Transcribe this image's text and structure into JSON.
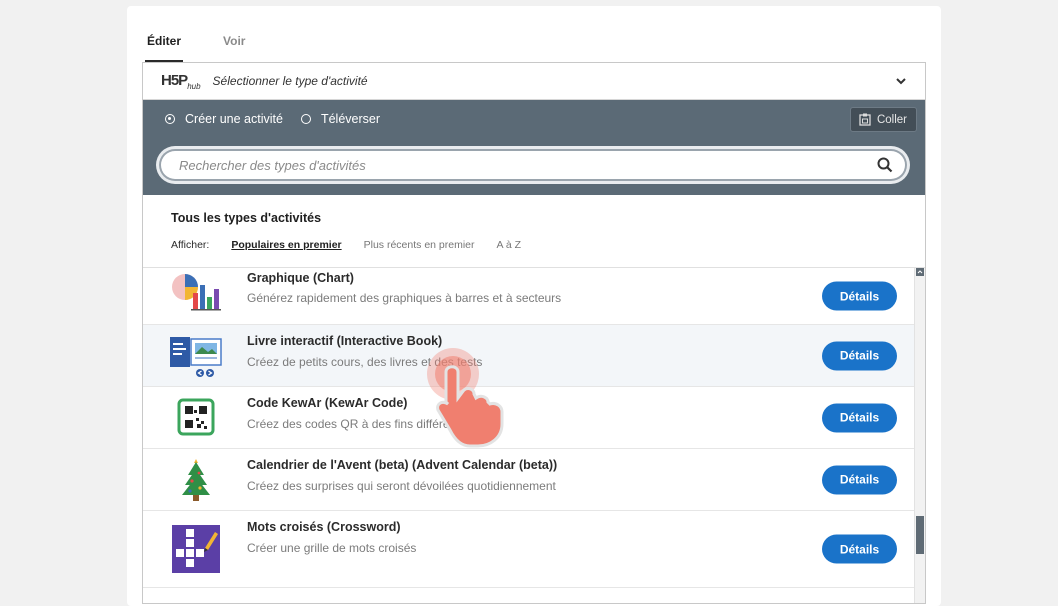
{
  "tabs": [
    {
      "label": "Éditer",
      "active": true
    },
    {
      "label": "Voir",
      "active": false
    }
  ],
  "hub": {
    "logo": "H5P",
    "logo_sub": "hub",
    "title": "Sélectionner le type d'activité"
  },
  "toolbar": {
    "create_label": "Créer une activité",
    "upload_label": "Téléverser",
    "paste_label": "Coller"
  },
  "search": {
    "placeholder": "Rechercher des types d'activités"
  },
  "list": {
    "heading": "Tous les types d'activités",
    "show_label": "Afficher:",
    "sort_options": [
      "Populaires en premier",
      "Plus récents en premier",
      "A à Z"
    ],
    "selected_sort": "Populaires en premier"
  },
  "items": [
    {
      "name": "Graphique (Chart)",
      "desc": "Générez rapidement des graphiques à barres et à secteurs",
      "button": "Détails",
      "icon": "chart-icon"
    },
    {
      "name": "Livre interactif (Interactive Book)",
      "desc": "Créez de petits cours, des livres et des tests",
      "button": "Détails",
      "icon": "interactive-book-icon"
    },
    {
      "name": "Code KewAr (KewAr Code)",
      "desc": "Créez des codes QR à des fins différentes",
      "button": "Détails",
      "icon": "qr-code-icon"
    },
    {
      "name": "Calendrier de l'Avent (beta) (Advent Calendar (beta))",
      "desc": "Créez des surprises qui seront dévoilées quotidiennement",
      "button": "Détails",
      "icon": "christmas-tree-icon"
    },
    {
      "name": "Mots croisés (Crossword)",
      "desc": "Créer une grille de mots croisés",
      "button": "Détails",
      "icon": "crossword-icon"
    }
  ],
  "colors": {
    "accent": "#1a73c9",
    "toolbar": "#5b6a76",
    "cursor": "#f07f6f"
  }
}
